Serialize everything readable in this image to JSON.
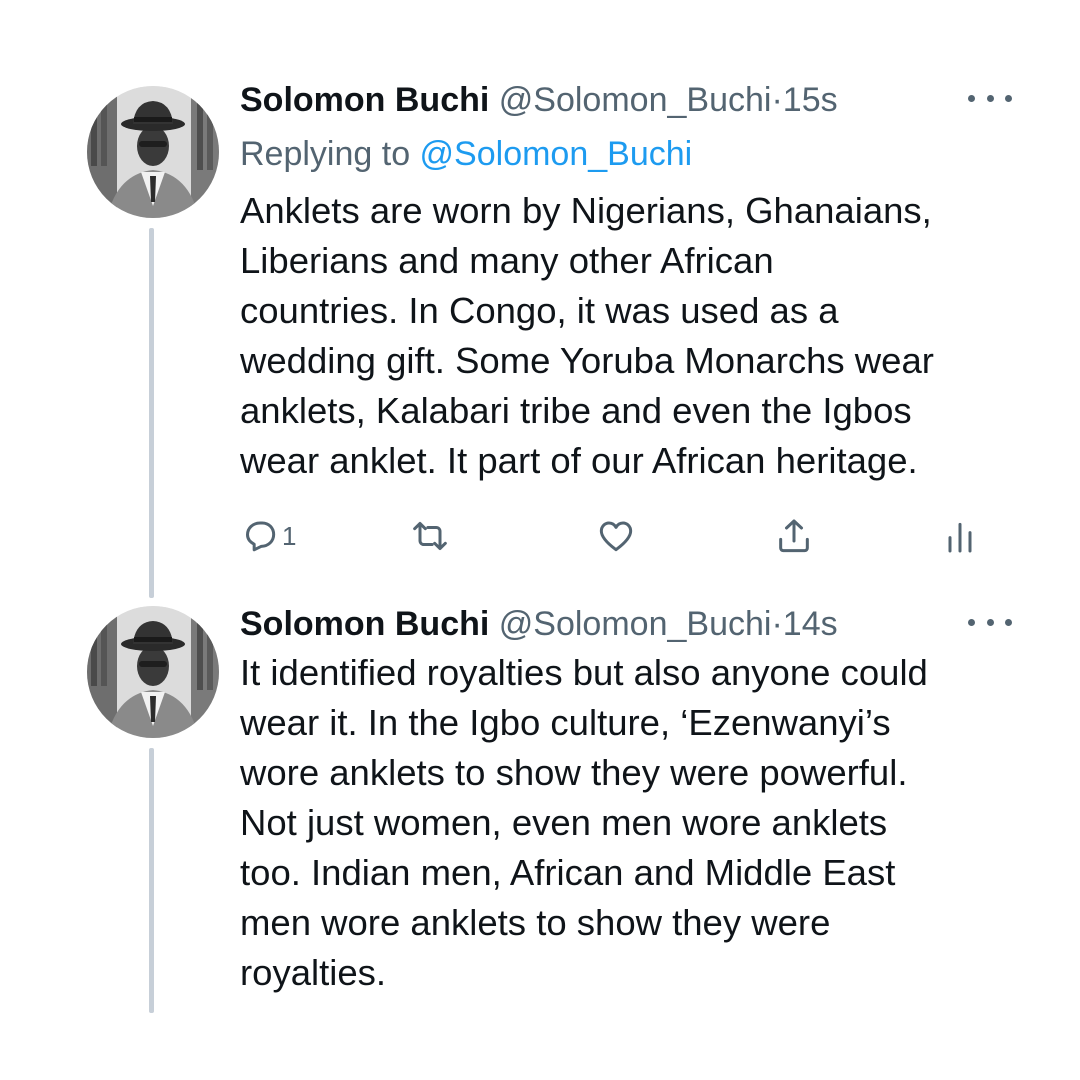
{
  "tweets": [
    {
      "author": {
        "display_name": "Solomon Buchi",
        "handle": "@Solomon_Buchi",
        "avatar_icon": "profile-photo"
      },
      "separator": "·",
      "time": "15s",
      "replying_to_prefix": "Replying to ",
      "replying_to_handle": "@Solomon_Buchi",
      "text": "Anklets are worn by Nigerians, Ghanaians,\nLiberians and many other African\ncountries. In Congo, it was used as a\nwedding gift. Some Yoruba Monarchs wear\nanklets, Kalabari tribe and even the Igbos\nwear anklet. It part of our African heritage.",
      "actions": {
        "reply_count": "1",
        "retweet_count": "",
        "like_count": ""
      }
    },
    {
      "author": {
        "display_name": "Solomon Buchi",
        "handle": "@Solomon_Buchi",
        "avatar_icon": "profile-photo"
      },
      "separator": "·",
      "time": "14s",
      "text": "It identified royalties but also anyone could\nwear it. In the Igbo culture, ‘Ezenwanyi’s\nwore anklets to show they were powerful.\nNot just women, even men wore anklets\ntoo. Indian men, African and Middle East\nmen wore anklets to show they were\nroyalties."
    }
  ],
  "colors": {
    "text": "#0f1419",
    "muted": "#536471",
    "link": "#1d9bf0",
    "thread_line": "#c7cfd8"
  }
}
